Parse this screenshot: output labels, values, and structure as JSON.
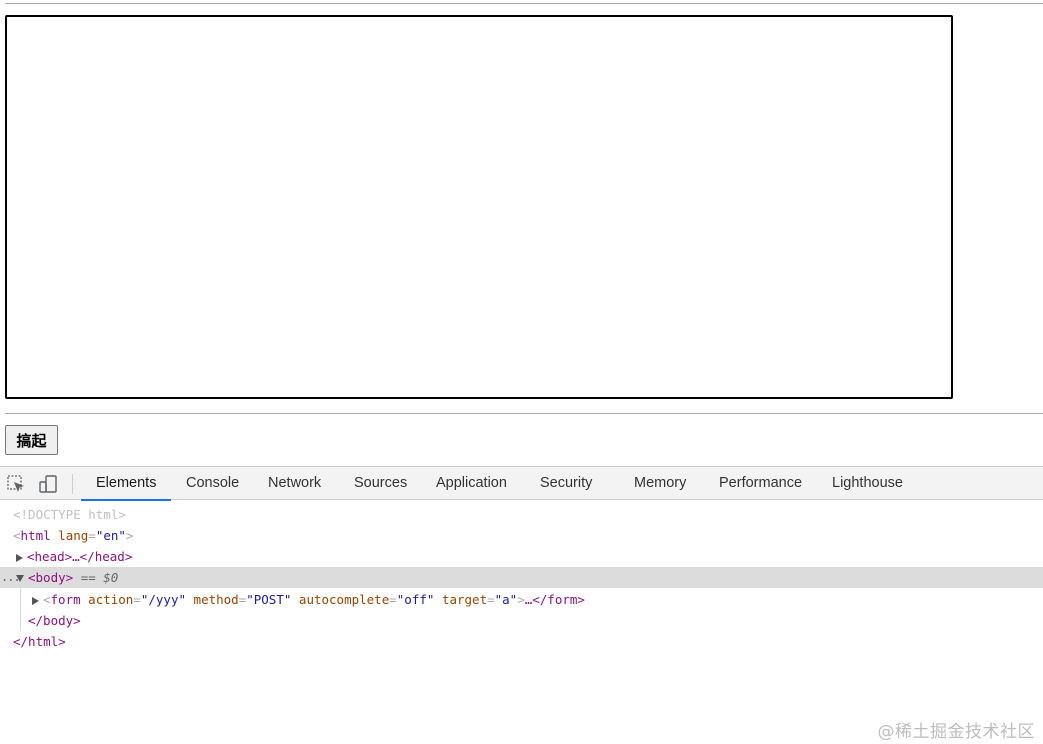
{
  "page": {
    "submit_button": "搞起"
  },
  "devtools": {
    "tabs": [
      "Elements",
      "Console",
      "Network",
      "Sources",
      "Application",
      "Security",
      "Memory",
      "Performance",
      "Lighthouse"
    ],
    "active_tab": "Elements",
    "icons": {
      "inspect": "select-element-icon",
      "device": "device-toolbar-icon"
    },
    "accent_color": "#1a73e8"
  },
  "dom": {
    "doctype": "<!DOCTYPE html>",
    "html_tag": "html",
    "html_lang_attr": "lang",
    "html_lang_value": "\"en\"",
    "head_text": "<head>…</head>",
    "body_open": "<body>",
    "body_selected_hint": "== $0",
    "form_tag": "form",
    "form_action_attr": "action",
    "form_action_value": "\"/yyy\"",
    "form_method_attr": "method",
    "form_method_value": "\"POST\"",
    "form_autocomplete_attr": "autocomplete",
    "form_autocomplete_value": "\"off\"",
    "form_target_attr": "target",
    "form_target_value": "\"a\"",
    "form_close": "…</form>",
    "body_close": "</body>",
    "html_close": "</html>",
    "row_ellipsis": "..."
  },
  "watermark": "@稀土掘金技术社区"
}
